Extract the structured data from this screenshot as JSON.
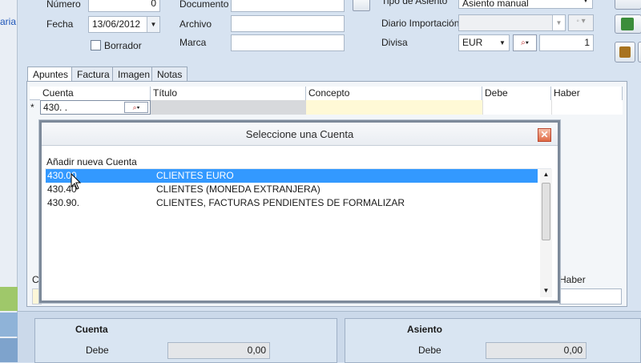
{
  "header": {
    "numero_label": "Número",
    "numero_value": "0",
    "fecha_label": "Fecha",
    "fecha_value": "13/06/2012",
    "borrador_label": "Borrador",
    "documento_label": "Documento",
    "archivo_label": "Archivo",
    "marca_label": "Marca",
    "tipo_asiento_label": "Tipo de Asiento",
    "tipo_asiento_value": "Asiento manual",
    "diario_label": "Diario Importación",
    "divisa_label": "Divisa",
    "divisa_value": "EUR",
    "divisa_rate": "1",
    "left_cut_text": "aria"
  },
  "tabs": [
    "Apuntes",
    "Factura",
    "Imagen",
    "Notas"
  ],
  "grid": {
    "columns": [
      "Cuenta",
      "Título",
      "Concepto",
      "Debe",
      "Haber"
    ],
    "row_marker": "*",
    "row_cuenta": "430. ."
  },
  "dialog": {
    "title": "Seleccione una Cuenta",
    "add_new": "Añadir nueva Cuenta",
    "items": [
      {
        "code": "430.00",
        "desc": "CLIENTES EURO"
      },
      {
        "code": "430.40",
        "desc": "CLIENTES (MONEDA EXTRANJERA)"
      },
      {
        "code": "430.90.",
        "desc": "CLIENTES, FACTURAS PENDIENTES DE FORMALIZAR"
      }
    ]
  },
  "behind_dialog": {
    "haber_label": "Haber",
    "c_label": "C"
  },
  "footer": {
    "cuenta_title": "Cuenta",
    "cuenta_debe_label": "Debe",
    "cuenta_debe_value": "0,00",
    "asiento_title": "Asiento",
    "asiento_debe_label": "Debe",
    "asiento_debe_value": "0,00"
  },
  "colors": {
    "selection": "#3399ff",
    "panel_bg": "#d7e3f1",
    "dialog_title_bg": "#f4f6f9"
  }
}
